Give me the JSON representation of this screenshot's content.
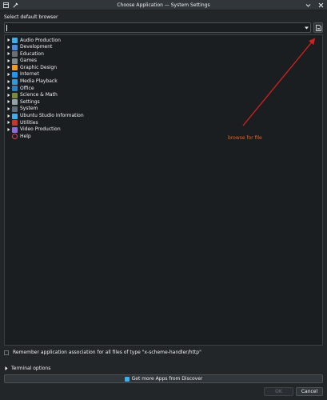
{
  "window": {
    "title": "Choose Application — System Settings"
  },
  "dialog": {
    "prompt": "Select default browser",
    "input_value": "",
    "categories": [
      {
        "label": "Audio Production",
        "icon": "audio-production-icon",
        "color": "#3daee9",
        "expandable": true
      },
      {
        "label": "Development",
        "icon": "development-icon",
        "color": "#4f8cdb",
        "expandable": true
      },
      {
        "label": "Education",
        "icon": "education-icon",
        "color": "#6c6f73",
        "expandable": true
      },
      {
        "label": "Games",
        "icon": "games-icon",
        "color": "#7f8c8d",
        "expandable": true
      },
      {
        "label": "Graphic Design",
        "icon": "graphic-design-icon",
        "color": "#f39c1f",
        "expandable": true
      },
      {
        "label": "Internet",
        "icon": "internet-icon",
        "color": "#1d99f3",
        "expandable": true
      },
      {
        "label": "Media Playback",
        "icon": "media-playback-icon",
        "color": "#3498db",
        "expandable": true
      },
      {
        "label": "Office",
        "icon": "office-icon",
        "color": "#2980b9",
        "expandable": true
      },
      {
        "label": "Science & Math",
        "icon": "science-math-icon",
        "color": "#7b8a3e",
        "expandable": true
      },
      {
        "label": "Settings",
        "icon": "settings-icon",
        "color": "#95a5a6",
        "expandable": true
      },
      {
        "label": "System",
        "icon": "system-icon",
        "color": "#5d6d7e",
        "expandable": true
      },
      {
        "label": "Ubuntu Studio Information",
        "icon": "ubuntu-studio-icon",
        "color": "#3daee9",
        "expandable": true
      },
      {
        "label": "Utilities",
        "icon": "utilities-icon",
        "color": "#c0392b",
        "expandable": true
      },
      {
        "label": "Video Production",
        "icon": "video-production-icon",
        "color": "#8e6cd8",
        "expandable": true
      },
      {
        "label": "Help",
        "icon": "help-icon",
        "color": "#da4453",
        "expandable": false
      }
    ],
    "annotation": "browse for file",
    "remember_label": "Remember application association for all files of type \"x-scheme-handler/http\"",
    "terminal_options": "Terminal options",
    "discover_button": "Get more Apps from Discover",
    "ok_button": "OK",
    "cancel_button": "Cancel"
  },
  "colors": {
    "background": "#232629",
    "panel": "#1b1e20",
    "annotation": "#e8601c",
    "arrow": "#d42020"
  }
}
